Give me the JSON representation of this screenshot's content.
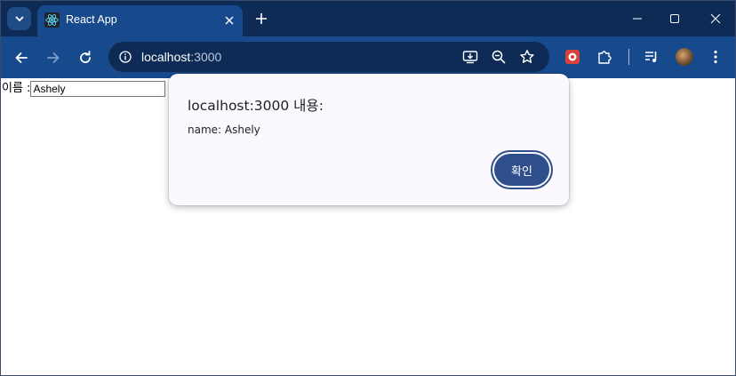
{
  "browser": {
    "tab": {
      "title": "React App",
      "favicon": "react-logo-icon"
    },
    "address": {
      "host": "localhost",
      "port": ":3000"
    },
    "window_controls": [
      "minimize",
      "maximize",
      "close"
    ]
  },
  "page": {
    "name_label": "이름 :",
    "name_value": "Ashely"
  },
  "dialog": {
    "title": "localhost:3000 내용:",
    "message": "name: Ashely",
    "ok_label": "확인"
  },
  "colors": {
    "titlebar": "#0d2b54",
    "toolbar": "#174a8d",
    "dialog_button": "#2e4f8b"
  }
}
